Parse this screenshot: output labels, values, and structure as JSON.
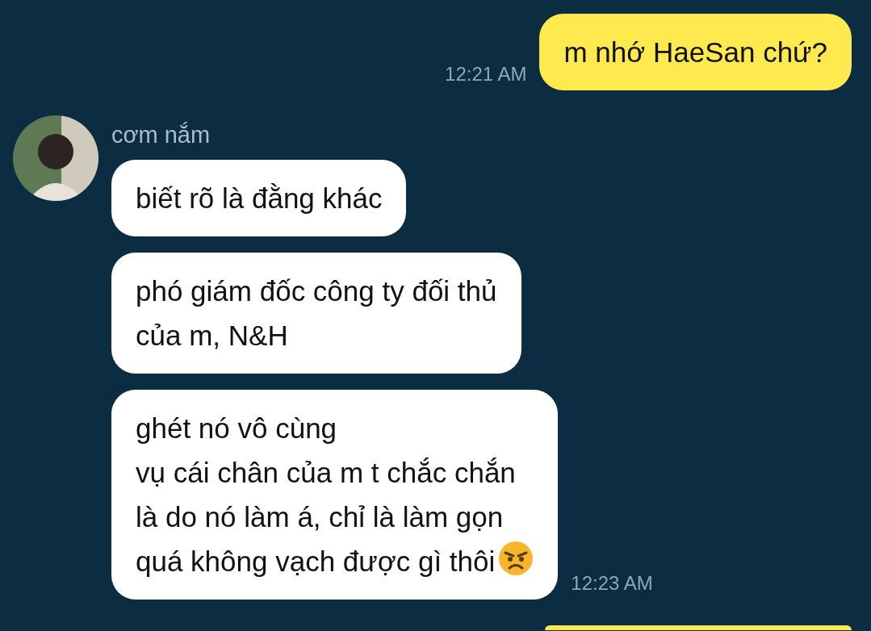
{
  "messages": [
    {
      "kind": "outgoing",
      "text": "m nhớ HaeSan chứ?",
      "time": "12:21 AM"
    },
    {
      "kind": "incoming",
      "sender": "cơm nắm",
      "bubbles": [
        {
          "text": "biết rõ là đằng khác"
        },
        {
          "text": "phó giám đốc công ty đối thủ\ncủa m, N&H"
        },
        {
          "text": "ghét nó vô cùng\nvụ cái chân của m t chắc chắn\nlà do nó làm á, chỉ là làm gọn\nquá không vạch được gì thôi",
          "ends_with_emoji": true
        }
      ],
      "time": "12:23 AM"
    },
    {
      "kind": "outgoing_clipped"
    }
  ]
}
